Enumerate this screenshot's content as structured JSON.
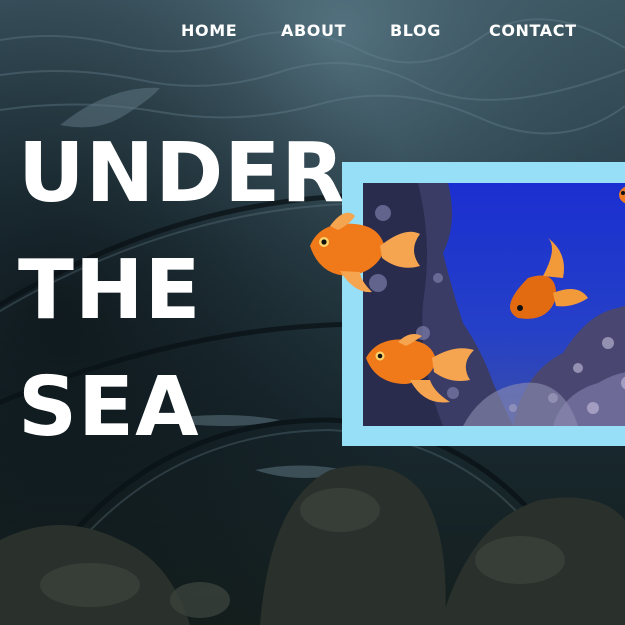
{
  "nav": {
    "items": [
      {
        "label": "HOME"
      },
      {
        "label": "ABOUT"
      },
      {
        "label": "BLOG"
      },
      {
        "label": "CONTACT"
      }
    ]
  },
  "hero": {
    "lines": [
      "UNDER",
      "THE",
      "SEA"
    ]
  },
  "colors": {
    "frame_border": "#96dff7",
    "nav_text": "#ffffff",
    "title_text": "#ffffff",
    "fish_body": "#f07a1a"
  },
  "images": {
    "background": "aquarium-tunnel-background",
    "frame_photo": "coral-reef-aquarium-photo",
    "fish": [
      "goldfish-icon",
      "goldfish-icon",
      "goldfish-icon"
    ]
  }
}
